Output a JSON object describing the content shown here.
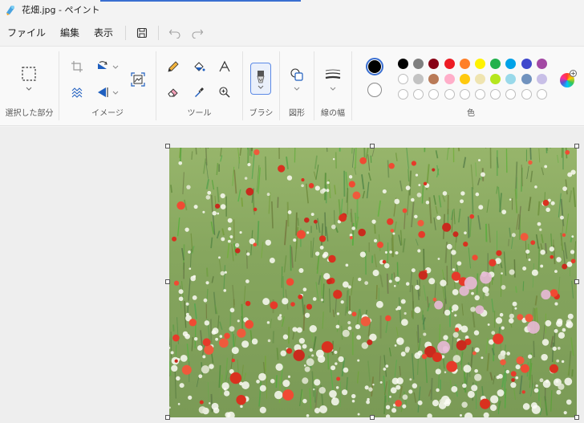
{
  "window": {
    "title": "花畑.jpg - ペイント"
  },
  "menu": {
    "file": "ファイル",
    "edit": "編集",
    "view": "表示"
  },
  "ribbon": {
    "selection_label": "選択した部分",
    "image_label": "イメージ",
    "tools_label": "ツール",
    "brush_label": "ブラシ",
    "shapes_label": "図形",
    "stroke_label": "線の幅",
    "colors_label": "色"
  },
  "colors": {
    "primary": "#000000",
    "secondary": "#ffffff",
    "row1": [
      "#000000",
      "#7f7f7f",
      "#880015",
      "#ed1c24",
      "#ff7f27",
      "#fff200",
      "#22b14c",
      "#00a2e8",
      "#3f48cc",
      "#a349a4"
    ],
    "row2": [
      "#ffffff",
      "#c3c3c3",
      "#b97a57",
      "#ffaec9",
      "#ffc90e",
      "#efe4b0",
      "#b5e61d",
      "#99d9ea",
      "#7092be",
      "#c8bfe7"
    ],
    "row3_custom_slots": 10
  }
}
